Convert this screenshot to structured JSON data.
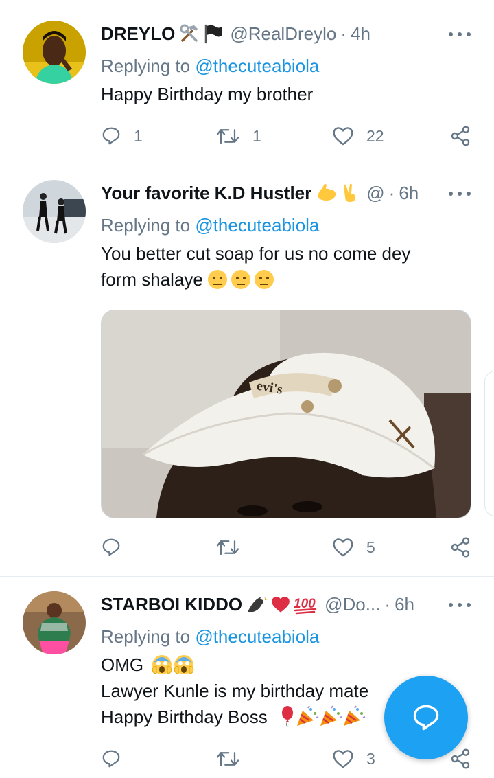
{
  "tweets": [
    {
      "name": "DREYLO",
      "badges": [
        "hammer-wrench-icon",
        "black-flag-icon"
      ],
      "handle": "@RealDreylo",
      "time": "4h",
      "reply_prefix": "Replying to",
      "reply_to": "@thecuteabiola",
      "text_lines": [
        "Happy Birthday my brother"
      ],
      "replies": "1",
      "retweets": "1",
      "likes": "22"
    },
    {
      "name": "Your favorite K.D Hustler",
      "badges": [
        "flexed-biceps-icon",
        "victory-hand-icon"
      ],
      "handle": "@",
      "time": "6h",
      "reply_prefix": "Replying to",
      "reply_to": "@thecuteabiola",
      "text_lines": [
        "You better cut soap for us no come dey",
        "form shalaye"
      ],
      "emoji_after_text": [
        "rolling-eyes-icon",
        "rolling-eyes-icon",
        "rolling-eyes-icon"
      ],
      "replies": "",
      "retweets": "",
      "likes": "5"
    },
    {
      "name": "STARBOI KIDDO",
      "badges": [
        "eagle-icon",
        "red-heart-icon",
        "hundred-points-icon"
      ],
      "handle": "@Do...",
      "time": "6h",
      "reply_prefix": "Replying to",
      "reply_to": "@thecuteabiola",
      "text_lines": [
        "OMG",
        "Lawyer Kunle is my birthday mate",
        "Happy Birthday Boss"
      ],
      "replies": "",
      "retweets": "",
      "likes": "3"
    }
  ],
  "separators": {
    "dot": "·"
  },
  "colors": {
    "accent": "#1da1f2",
    "mention": "#1b95e0",
    "secondary_text": "#657786",
    "divider": "#e6ecf0"
  },
  "fab": {
    "icon": "compose-reply-icon"
  }
}
